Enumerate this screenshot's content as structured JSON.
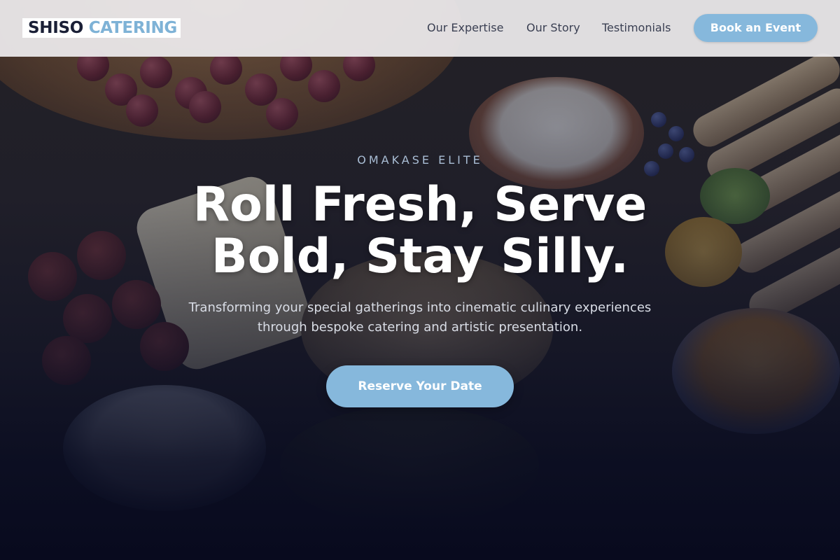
{
  "brand": {
    "word1": "SHISO",
    "word2": "CATERING",
    "dark_color": "#1a1f36",
    "accent_color": "#7eb2d6"
  },
  "nav": {
    "items": [
      {
        "label": "Our Expertise"
      },
      {
        "label": "Our Story"
      },
      {
        "label": "Testimonials"
      }
    ],
    "cta_label": "Book an Event"
  },
  "hero": {
    "eyebrow": "OMAKASE ELITE",
    "headline_line1": "Roll Fresh, Serve",
    "headline_line2": "Bold, Stay Silly.",
    "subtitle": "Transforming your special gatherings into cinematic culinary experiences through bespoke catering and artistic presentation.",
    "cta_label": "Reserve Your Date",
    "button_color": "#86b8dc",
    "background_color": "#0b1024"
  }
}
